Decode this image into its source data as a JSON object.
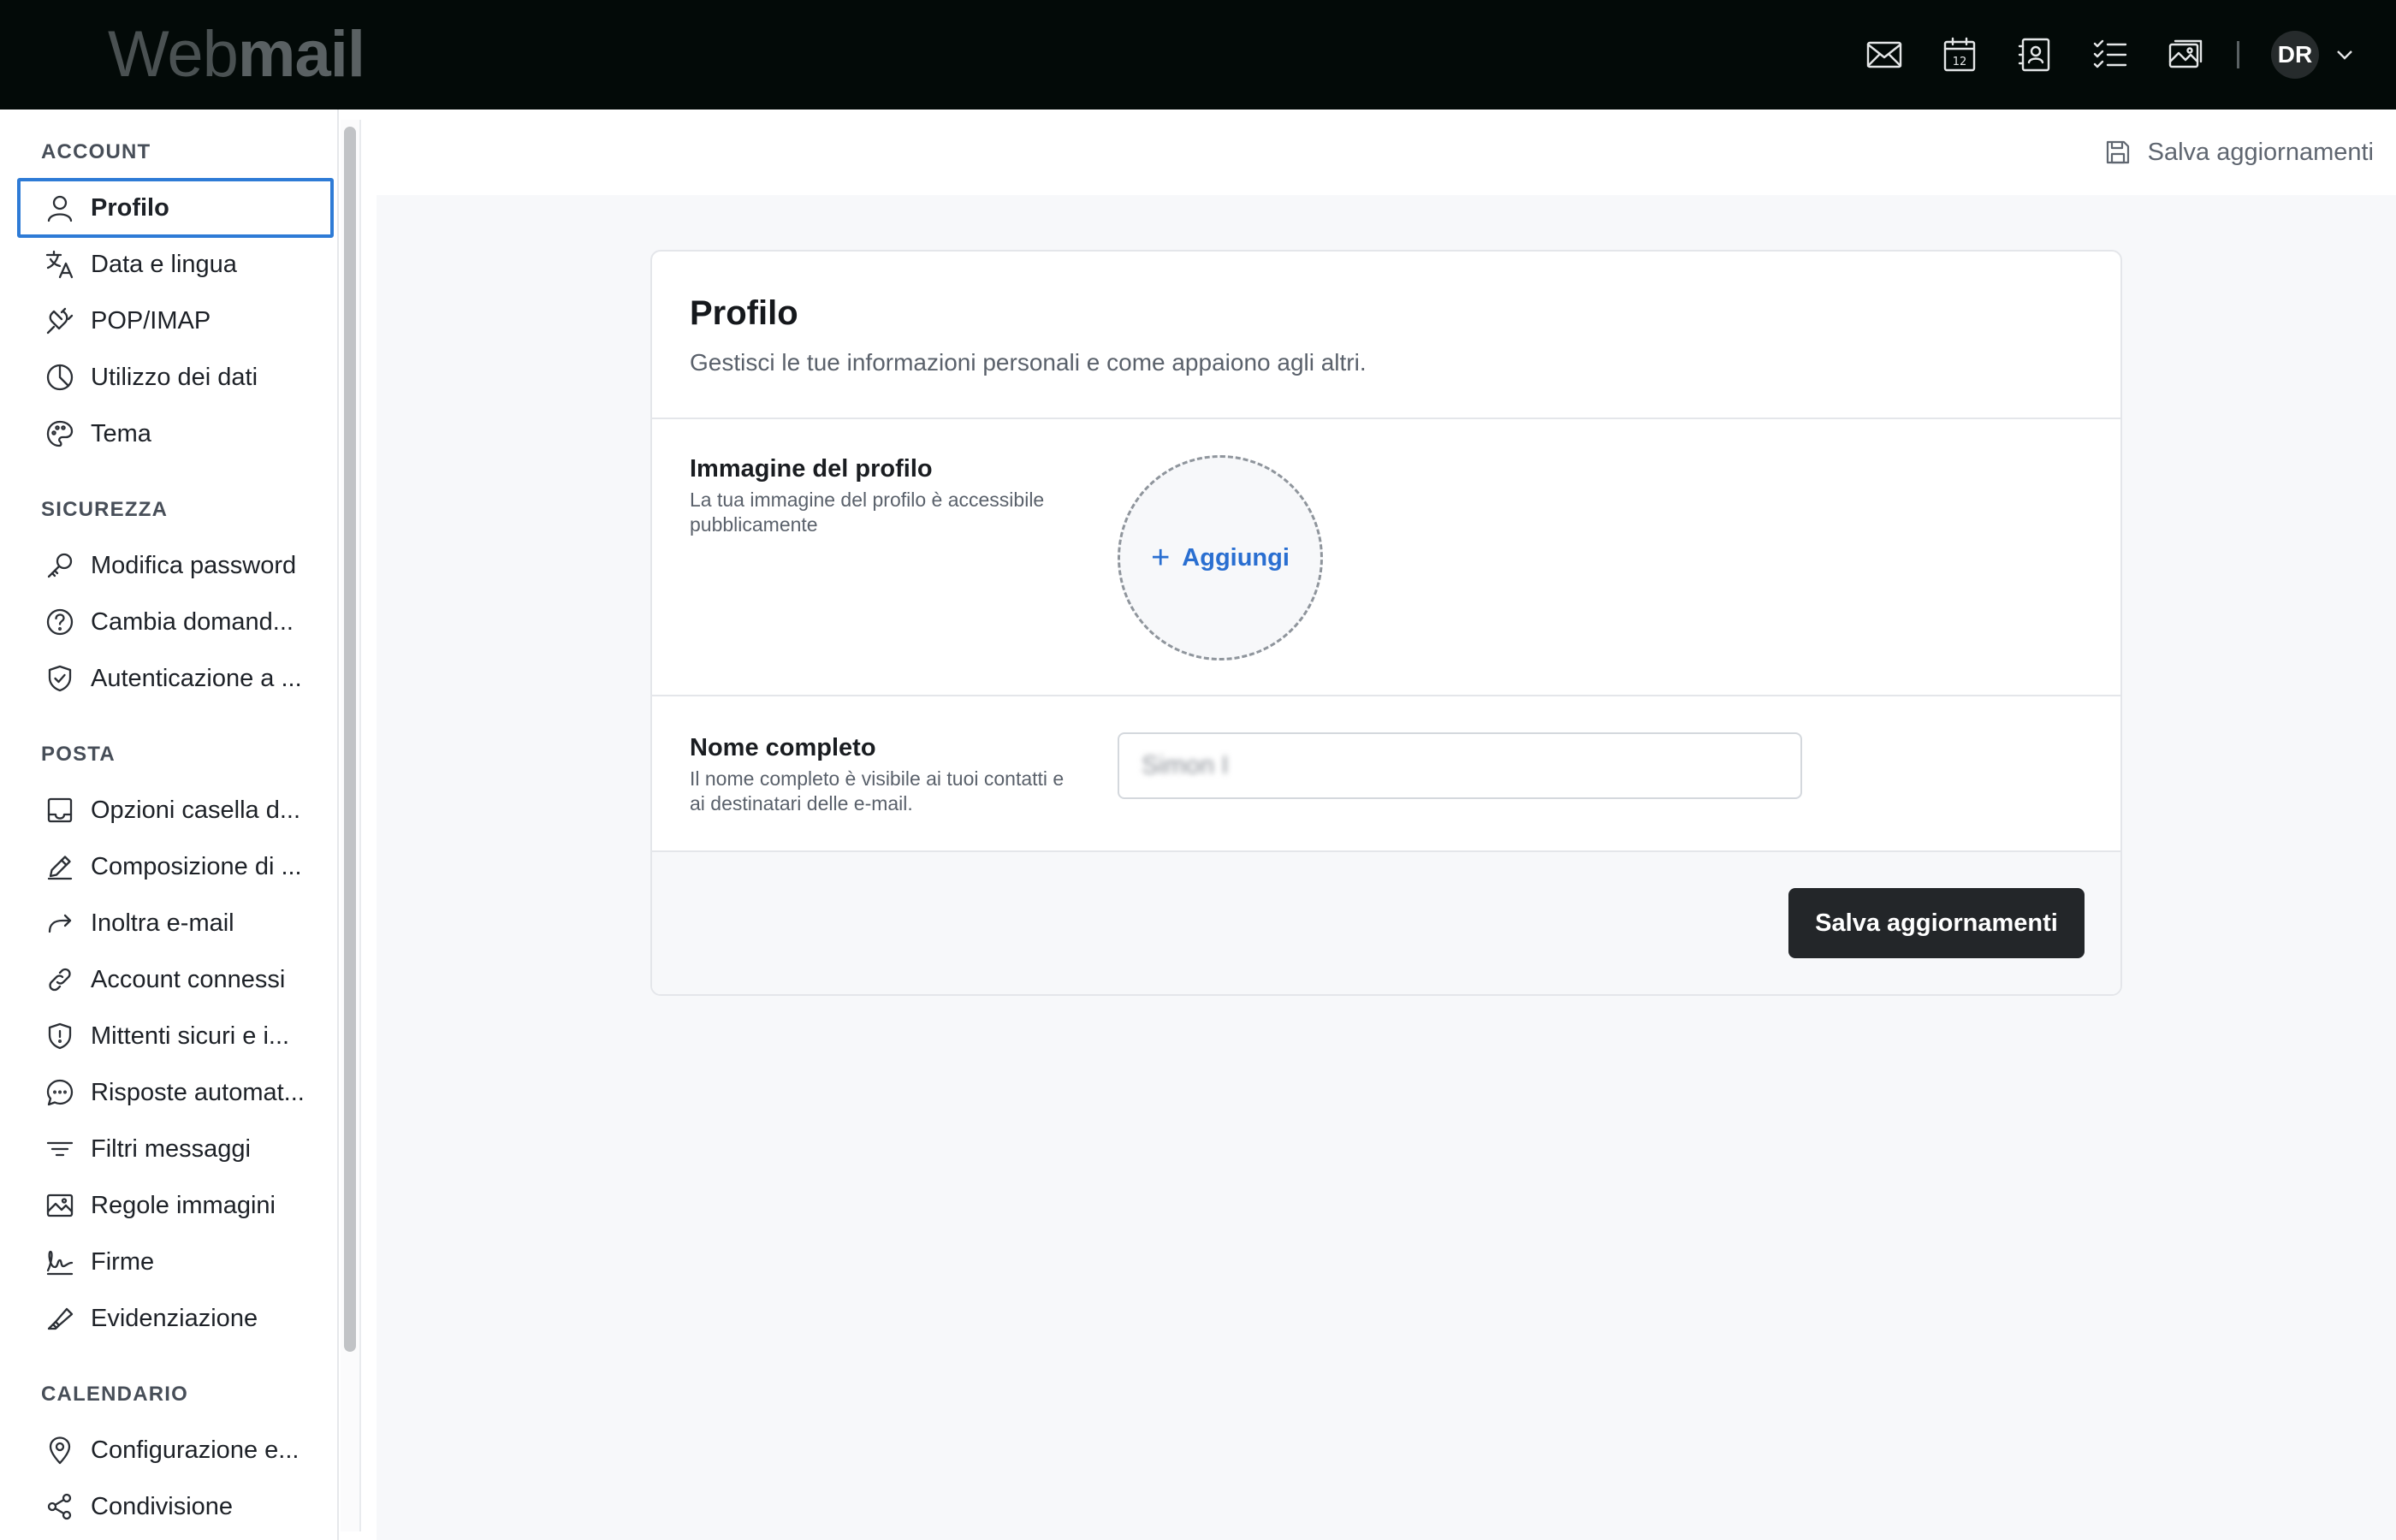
{
  "app": {
    "logo_light": "Web",
    "logo_bold": "mail"
  },
  "topbar": {
    "icons": [
      "mail-icon",
      "calendar-icon",
      "contacts-icon",
      "tasks-icon",
      "photos-icon"
    ],
    "calendar_day": "12",
    "avatar_initials": "DR"
  },
  "header": {
    "save_label": "Salva aggiornamenti"
  },
  "sidebar": {
    "sections": [
      {
        "title": "ACCOUNT",
        "items": [
          {
            "label": "Profilo",
            "icon": "user-icon",
            "active": true
          },
          {
            "label": "Data e lingua",
            "icon": "translate-icon"
          },
          {
            "label": "POP/IMAP",
            "icon": "plug-icon"
          },
          {
            "label": "Utilizzo dei dati",
            "icon": "pie-chart-icon"
          },
          {
            "label": "Tema",
            "icon": "palette-icon"
          }
        ]
      },
      {
        "title": "SICUREZZA",
        "items": [
          {
            "label": "Modifica password",
            "icon": "key-icon"
          },
          {
            "label": "Cambia domand...",
            "icon": "question-icon"
          },
          {
            "label": "Autenticazione a ...",
            "icon": "shield-check-icon"
          }
        ]
      },
      {
        "title": "POSTA",
        "items": [
          {
            "label": "Opzioni casella d...",
            "icon": "inbox-icon"
          },
          {
            "label": "Composizione di ...",
            "icon": "pencil-icon"
          },
          {
            "label": "Inoltra e-mail",
            "icon": "forward-icon"
          },
          {
            "label": "Account connessi",
            "icon": "link-icon"
          },
          {
            "label": "Mittenti sicuri e i...",
            "icon": "shield-alert-icon"
          },
          {
            "label": "Risposte automat...",
            "icon": "chat-icon"
          },
          {
            "label": "Filtri messaggi",
            "icon": "filter-icon"
          },
          {
            "label": "Regole immagini",
            "icon": "image-icon"
          },
          {
            "label": "Firme",
            "icon": "signature-icon"
          },
          {
            "label": "Evidenziazione",
            "icon": "highlighter-icon"
          }
        ]
      },
      {
        "title": "CALENDARIO",
        "items": [
          {
            "label": "Configurazione e...",
            "icon": "location-icon"
          },
          {
            "label": "Condivisione",
            "icon": "share-icon"
          }
        ]
      }
    ]
  },
  "card": {
    "title": "Profilo",
    "subtitle": "Gestisci le tue informazioni personali e come appaiono agli altri.",
    "picture": {
      "label": "Immagine del profilo",
      "desc": "La tua immagine del profilo è accessibile pubblicamente",
      "add_label": "Aggiungi"
    },
    "fullname": {
      "label": "Nome completo",
      "desc": "Il nome completo è visibile ai tuoi contatti e ai destinatari delle e-mail.",
      "value": "Simon I"
    },
    "save_button": "Salva aggiornamenti"
  }
}
